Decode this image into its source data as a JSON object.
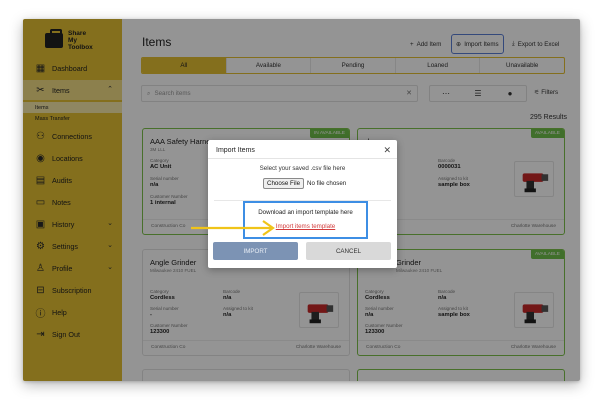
{
  "app": {
    "logo_text": [
      "Share",
      "My",
      "Toolbox"
    ]
  },
  "sidebar": {
    "items": [
      {
        "label": "Dashboard",
        "icon": "grid-icon"
      },
      {
        "label": "Items",
        "icon": "tools-icon"
      },
      {
        "label": "Connections",
        "icon": "people-icon"
      },
      {
        "label": "Locations",
        "icon": "pin-icon"
      },
      {
        "label": "Audits",
        "icon": "clipboard-icon"
      },
      {
        "label": "Notes",
        "icon": "note-icon"
      },
      {
        "label": "History",
        "icon": "history-icon"
      },
      {
        "label": "Settings",
        "icon": "gear-icon"
      },
      {
        "label": "Profile",
        "icon": "user-icon"
      },
      {
        "label": "Subscription",
        "icon": "subscription-icon"
      },
      {
        "label": "Help",
        "icon": "help-icon"
      },
      {
        "label": "Sign Out",
        "icon": "signout-icon"
      }
    ],
    "subitems": [
      "Items",
      "Mass Transfer"
    ]
  },
  "header": {
    "title": "Items",
    "add_item": "Add Item",
    "import_items": "Import Items",
    "export": "Export to Excel"
  },
  "tabs": [
    "All",
    "Available",
    "Pending",
    "Loaned",
    "Unavailable"
  ],
  "search": {
    "placeholder": "Search items"
  },
  "filters_label": "Filters",
  "results": "295 Results",
  "cards": [
    {
      "name": "AAA Safety Harness",
      "sub": "3M LLL",
      "badge": "IN AVAILABLE",
      "category": "AC Unit",
      "serial": "n/a",
      "customer_number": "1 internal",
      "footer_left": "Construction Co",
      "footer_right": ""
    },
    {
      "name": "der",
      "sub": "",
      "badge": "AVAILABLE",
      "barcode": "0000031",
      "assigned": "sample box",
      "serial_partial": "86",
      "footer_left": "",
      "footer_right": "Charlotte Warehouse"
    },
    {
      "name": "Angle Grinder",
      "sub": "Milwaukee 2410 FUEL",
      "badge": "",
      "category": "Cordless",
      "barcode": "n/a",
      "serial": "-",
      "assigned": "n/a",
      "customer_number": "123300",
      "footer_left": "Construction Co",
      "footer_right": "Charlotte Warehouse"
    },
    {
      "name": "Grinder",
      "sub": "Milwaukee 2410 FUEL",
      "badge": "AVAILABLE",
      "category": "Cordless",
      "barcode": "n/a",
      "serial": "n/a",
      "assigned": "sample box",
      "customer_number": "123300",
      "footer_left": "Construction Co",
      "footer_right": "Charlotte Warehouse"
    }
  ],
  "labels": {
    "category": "Category",
    "barcode": "Barcode",
    "serial": "Serial number",
    "assigned": "Assigned to kit",
    "customer": "Customer Number"
  },
  "modal": {
    "title": "Import Items",
    "prompt": "Select your saved .csv file here",
    "choose_file": "Choose File",
    "no_file": "No file chosen",
    "template_text": "Download an import template here",
    "template_link": "Import items template",
    "import_button": "IMPORT",
    "cancel_button": "CANCEL"
  },
  "colors": {
    "sidebar": "#e3bf32",
    "available": "#6fbf4a",
    "highlight": "#3d8ee4",
    "arrow": "#f0c419"
  }
}
